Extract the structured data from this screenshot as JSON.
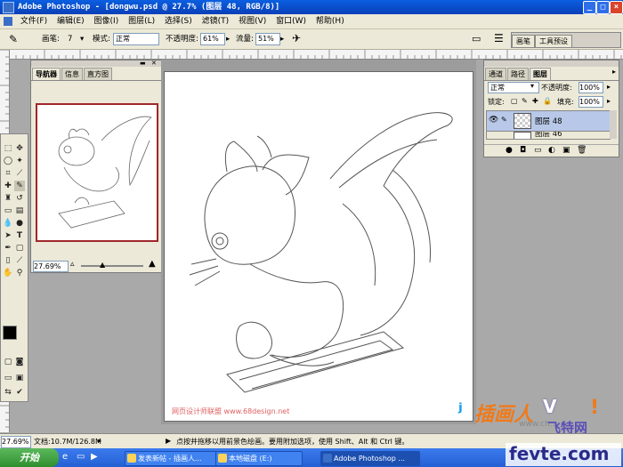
{
  "app": {
    "title": "Adobe Photoshop - [dongwu.psd @ 27.7% (图层 48, RGB/8)]"
  },
  "menu": [
    "文件(F)",
    "编辑(E)",
    "图像(I)",
    "图层(L)",
    "选择(S)",
    "滤镜(T)",
    "视图(V)",
    "窗口(W)",
    "帮助(H)"
  ],
  "options": {
    "brush_label": "画笔:",
    "brush_size": "7",
    "mode_label": "模式:",
    "mode_value": "正常",
    "opacity_label": "不透明度:",
    "opacity_value": "61%",
    "flow_label": "流量:",
    "flow_value": "51%",
    "well_tabs": [
      "画笔",
      "工具预设"
    ]
  },
  "navigator": {
    "tabs": [
      "导航器",
      "信息",
      "直方图"
    ],
    "zoom": "27.69%"
  },
  "layers": {
    "tabs": [
      "通道",
      "路径",
      "图层"
    ],
    "blend_mode": "正常",
    "opacity_label": "不透明度:",
    "opacity_value": "100%",
    "lock_label": "锁定:",
    "fill_label": "填充:",
    "fill_value": "100%",
    "rows": [
      {
        "name": "图层 48",
        "selected": true
      },
      {
        "name": "图层 46",
        "selected": false
      }
    ]
  },
  "canvas": {
    "watermark": "网页设计师联盟 www.68design.net"
  },
  "status": {
    "zoom": "27.69%",
    "doc_label": "文档:10.7M/126.8M",
    "hint": "点按并拖移以用前景色绘画。要用附加选项，使用 Shift、Alt 和 Ctrl 键。"
  },
  "taskbar": {
    "start": "开始",
    "tasks": [
      "发表新帖 - 插画人...",
      "本地磁盘 (E:)",
      "Adobe Photoshop ..."
    ]
  },
  "overlay": {
    "logo_text": "插画人",
    "site_cn": "飞特网",
    "site_en": "fevte.com",
    "watermark2": "www.ch..."
  },
  "colors": {
    "titlebar": "#0a4fd0",
    "panel": "#ece9d8",
    "taskbar": "#2460d4",
    "watermark": "#e06060"
  }
}
